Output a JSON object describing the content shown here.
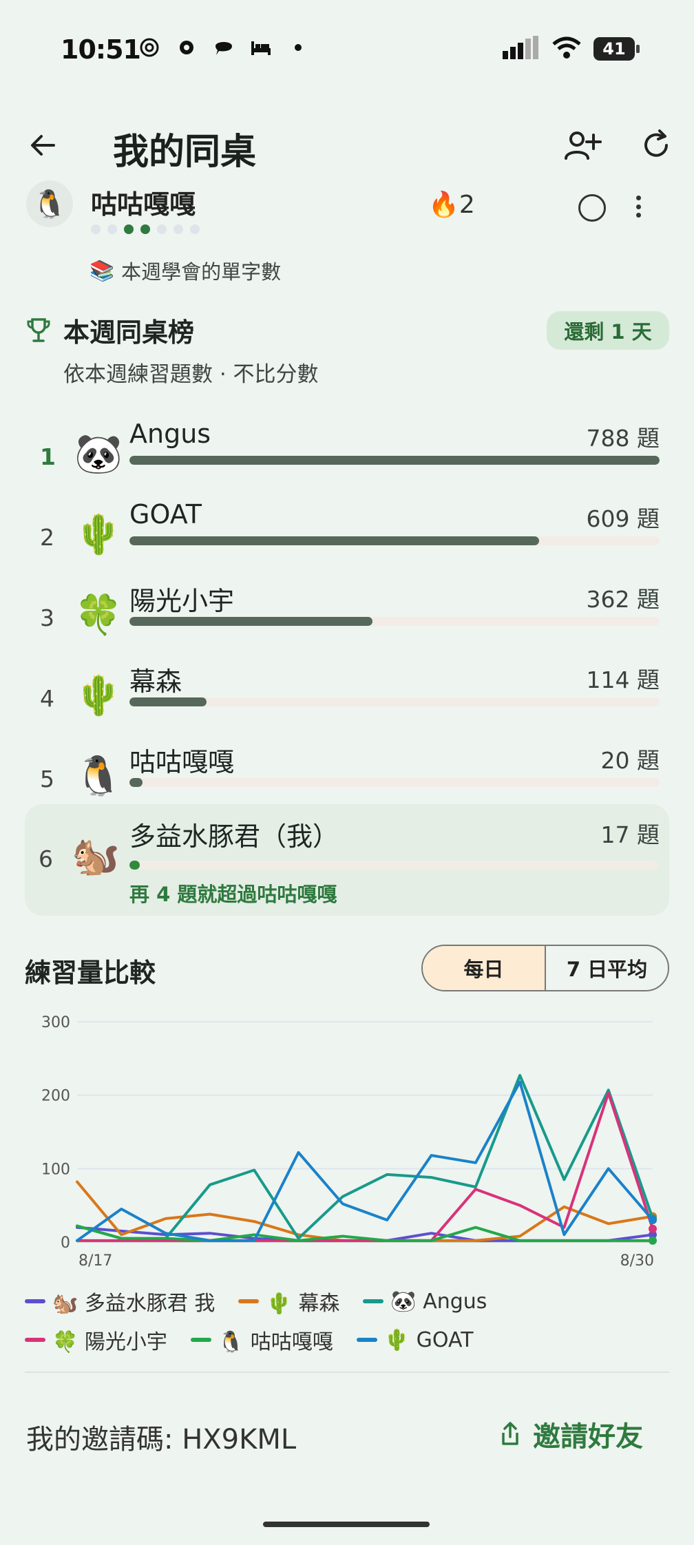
{
  "status_bar": {
    "time": "10:51",
    "battery": "41"
  },
  "header": {
    "title": "我的同桌"
  },
  "friend_partial": {
    "avatar": "🐧",
    "name": "咕咕嘎嘎",
    "streak": "🔥2",
    "weekly_words_icon": "📚",
    "weekly_words_label": "本週學會的單字數"
  },
  "leaderboard": {
    "title": "本週同桌榜",
    "days_left": "還剩 1 天",
    "subtitle": "依本週練習題數 · 不比分數",
    "rows": [
      {
        "rank": "1",
        "emoji": "🐼",
        "name": "Angus",
        "count": "788 題",
        "fraction": 1.0
      },
      {
        "rank": "2",
        "emoji": "🌵",
        "name": "GOAT",
        "count": "609 題",
        "fraction": 0.773
      },
      {
        "rank": "3",
        "emoji": "🍀",
        "name": "陽光小宇",
        "count": "362 題",
        "fraction": 0.459
      },
      {
        "rank": "4",
        "emoji": "🌵",
        "name": "幕森",
        "count": "114 題",
        "fraction": 0.145
      },
      {
        "rank": "5",
        "emoji": "🐧",
        "name": "咕咕嘎嘎",
        "count": "20 題",
        "fraction": 0.025
      }
    ],
    "me": {
      "rank": "6",
      "emoji": "🐿️",
      "name": "多益水豚君（我）",
      "count": "17 題",
      "fraction": 0.02,
      "hint": "再 4 題就超過咕咕嘎嘎"
    }
  },
  "comparison": {
    "title": "練習量比較",
    "tabs": [
      "每日",
      "7 日平均"
    ],
    "active_tab": "每日"
  },
  "chart_data": {
    "type": "line",
    "x": [
      "8/17",
      "8/18",
      "8/19",
      "8/20",
      "8/21",
      "8/22",
      "8/23",
      "8/24",
      "8/25",
      "8/26",
      "8/27",
      "8/28",
      "8/29",
      "8/30"
    ],
    "x_tick_labels": [
      "8/17",
      "8/30"
    ],
    "ylim": [
      0,
      300
    ],
    "y_ticks": [
      0,
      100,
      200,
      300
    ],
    "grid": true,
    "legend_position": "bottom",
    "series": [
      {
        "name": "🐿️ 多益水豚君 我",
        "color": "#5b4fcf",
        "values": [
          20,
          15,
          10,
          12,
          5,
          2,
          2,
          2,
          12,
          2,
          2,
          2,
          2,
          10
        ]
      },
      {
        "name": "🌵 幕森",
        "color": "#d9771a",
        "values": [
          82,
          10,
          32,
          38,
          28,
          10,
          2,
          2,
          2,
          2,
          8,
          48,
          25,
          35
        ]
      },
      {
        "name": "🐼 Angus",
        "color": "#179a8c",
        "values": [
          22,
          5,
          5,
          78,
          98,
          5,
          62,
          92,
          88,
          75,
          227,
          85,
          207,
          32
        ]
      },
      {
        "name": "🍀 陽光小宇",
        "color": "#d8327a",
        "values": [
          2,
          2,
          2,
          2,
          2,
          2,
          2,
          2,
          2,
          72,
          50,
          20,
          203,
          18
        ]
      },
      {
        "name": "🐧 咕咕嘎嘎",
        "color": "#22a84a",
        "values": [
          22,
          5,
          5,
          2,
          10,
          2,
          8,
          2,
          2,
          20,
          2,
          2,
          2,
          2
        ]
      },
      {
        "name": "🌵 GOAT",
        "color": "#1a82c9",
        "values": [
          2,
          45,
          12,
          2,
          2,
          122,
          52,
          30,
          118,
          108,
          218,
          10,
          100,
          30
        ]
      }
    ]
  },
  "footer": {
    "invite_code": "我的邀請碼: HX9KML",
    "invite_button": "邀請好友"
  }
}
